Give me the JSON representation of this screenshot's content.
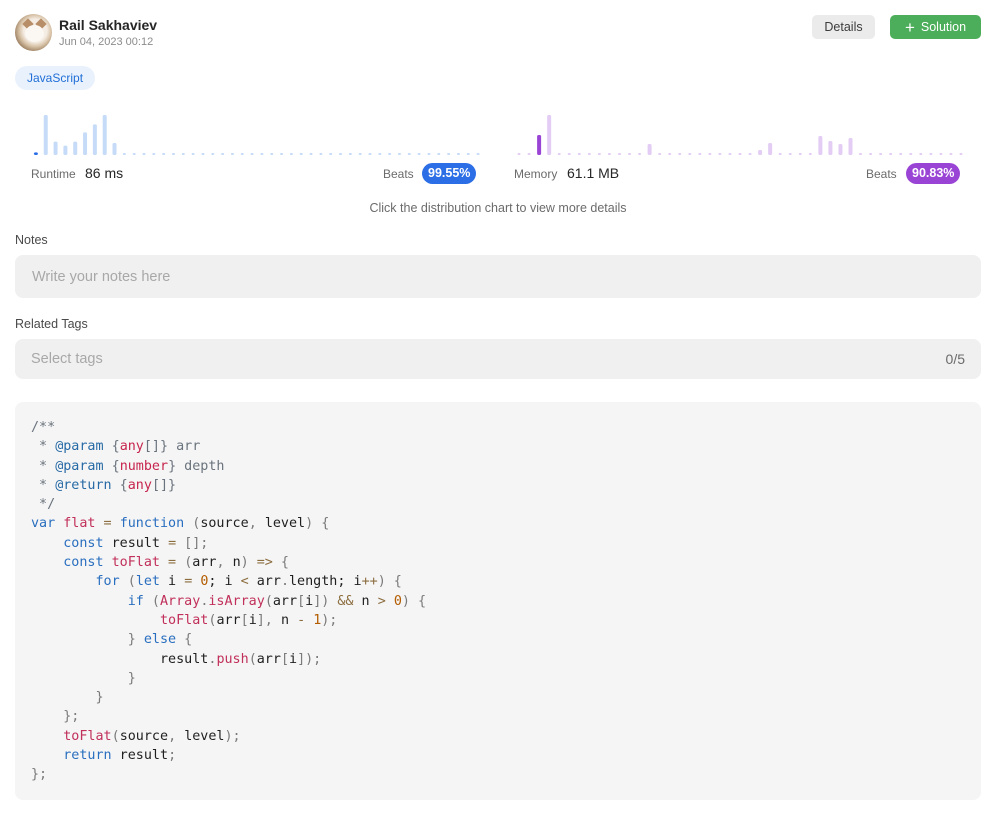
{
  "header": {
    "username": "Rail Sakhaviev",
    "date": "Jun 04, 2023 00:12",
    "details_label": "Details",
    "solution_label": "Solution"
  },
  "language_tag": "JavaScript",
  "runtime": {
    "label": "Runtime",
    "value": "86 ms",
    "beats_label": "Beats",
    "beats_value": "99.55%",
    "accent_color": "#2b6ee6",
    "bar_color": "#c5dbf7",
    "bars": [
      2,
      30,
      10,
      7,
      10,
      17,
      23,
      30,
      9,
      0,
      0,
      0,
      0,
      0,
      0,
      0,
      0,
      0,
      0,
      0,
      0,
      0,
      0,
      0,
      0,
      0,
      0,
      0,
      0,
      0,
      0,
      0,
      0,
      0,
      0,
      0,
      0,
      0,
      0,
      0,
      0,
      0,
      0,
      0,
      0,
      0
    ],
    "highlight_index": 0
  },
  "memory": {
    "label": "Memory",
    "value": "61.1 MB",
    "beats_label": "Beats",
    "beats_value": "90.83%",
    "accent_color": "#9a44d6",
    "bar_color": "#e3cdf4",
    "bars": [
      0,
      0,
      20,
      40,
      0,
      0,
      0,
      0,
      0,
      0,
      0,
      0,
      0,
      11,
      0,
      0,
      0,
      0,
      0,
      0,
      0,
      0,
      0,
      0,
      5,
      12,
      0,
      0,
      0,
      0,
      19,
      14,
      11,
      17,
      0,
      0,
      0,
      0,
      0,
      0,
      0,
      0,
      0,
      0,
      0
    ],
    "highlight_index": 2
  },
  "hint": "Click the distribution chart to view more details",
  "notes": {
    "label": "Notes",
    "placeholder": "Write your notes here"
  },
  "related_tags": {
    "label": "Related Tags",
    "placeholder": "Select tags",
    "count": "0/5"
  },
  "code": {
    "language": "javascript",
    "lines": [
      [
        [
          "/**",
          "comment"
        ]
      ],
      [
        [
          " * ",
          "comment"
        ],
        [
          "@param",
          "doctag"
        ],
        [
          " {",
          "comment"
        ],
        [
          "any",
          "type"
        ],
        [
          "[]} arr",
          "comment"
        ]
      ],
      [
        [
          " * ",
          "comment"
        ],
        [
          "@param",
          "doctag"
        ],
        [
          " {",
          "comment"
        ],
        [
          "number",
          "type"
        ],
        [
          "} depth",
          "comment"
        ]
      ],
      [
        [
          " * ",
          "comment"
        ],
        [
          "@return",
          "doctag"
        ],
        [
          " {",
          "comment"
        ],
        [
          "any",
          "type"
        ],
        [
          "[]}",
          "comment"
        ]
      ],
      [
        [
          " */",
          "comment"
        ]
      ],
      [
        [
          "var",
          "kw"
        ],
        [
          " ",
          "id"
        ],
        [
          "flat",
          "fn"
        ],
        [
          " = ",
          "op"
        ],
        [
          "function",
          "kw"
        ],
        [
          " (",
          "punc"
        ],
        [
          "source",
          "id"
        ],
        [
          ", ",
          "punc"
        ],
        [
          "level",
          "id"
        ],
        [
          ") {",
          "punc"
        ]
      ],
      [
        [
          "    ",
          "id"
        ],
        [
          "const",
          "kw"
        ],
        [
          " result ",
          "id"
        ],
        [
          "=",
          "op"
        ],
        [
          " [];",
          "punc"
        ]
      ],
      [
        [
          "    ",
          "id"
        ],
        [
          "const",
          "kw"
        ],
        [
          " ",
          "id"
        ],
        [
          "toFlat",
          "fn"
        ],
        [
          " = ",
          "op"
        ],
        [
          "(",
          "punc"
        ],
        [
          "arr",
          "id"
        ],
        [
          ", ",
          "punc"
        ],
        [
          "n",
          "id"
        ],
        [
          ") ",
          "punc"
        ],
        [
          "=>",
          "op"
        ],
        [
          " {",
          "punc"
        ]
      ],
      [
        [
          "        ",
          "id"
        ],
        [
          "for",
          "kw"
        ],
        [
          " (",
          "punc"
        ],
        [
          "let",
          "kw"
        ],
        [
          " i ",
          "id"
        ],
        [
          "=",
          "op"
        ],
        [
          " ",
          "id"
        ],
        [
          "0",
          "num"
        ],
        [
          "; i ",
          "id"
        ],
        [
          "<",
          "op"
        ],
        [
          " arr",
          "id"
        ],
        [
          ".",
          "punc"
        ],
        [
          "length",
          "id"
        ],
        [
          "; i",
          "id"
        ],
        [
          "++",
          "op"
        ],
        [
          ") {",
          "punc"
        ]
      ],
      [
        [
          "            ",
          "id"
        ],
        [
          "if",
          "kw"
        ],
        [
          " (",
          "punc"
        ],
        [
          "Array",
          "fn"
        ],
        [
          ".",
          "punc"
        ],
        [
          "isArray",
          "fn"
        ],
        [
          "(",
          "punc"
        ],
        [
          "arr",
          "id"
        ],
        [
          "[",
          "punc"
        ],
        [
          "i",
          "id"
        ],
        [
          "]) ",
          "punc"
        ],
        [
          "&&",
          "op"
        ],
        [
          " n ",
          "id"
        ],
        [
          ">",
          "op"
        ],
        [
          " ",
          "id"
        ],
        [
          "0",
          "num"
        ],
        [
          ") {",
          "punc"
        ]
      ],
      [
        [
          "                ",
          "id"
        ],
        [
          "toFlat",
          "fn"
        ],
        [
          "(",
          "punc"
        ],
        [
          "arr",
          "id"
        ],
        [
          "[",
          "punc"
        ],
        [
          "i",
          "id"
        ],
        [
          "], ",
          "punc"
        ],
        [
          "n ",
          "id"
        ],
        [
          "-",
          "op"
        ],
        [
          " ",
          "id"
        ],
        [
          "1",
          "num"
        ],
        [
          ");",
          "punc"
        ]
      ],
      [
        [
          "            ",
          "id"
        ],
        [
          "} ",
          "punc"
        ],
        [
          "else",
          "kw"
        ],
        [
          " {",
          "punc"
        ]
      ],
      [
        [
          "                ",
          "id"
        ],
        [
          "result",
          "id"
        ],
        [
          ".",
          "punc"
        ],
        [
          "push",
          "fn"
        ],
        [
          "(",
          "punc"
        ],
        [
          "arr",
          "id"
        ],
        [
          "[",
          "punc"
        ],
        [
          "i",
          "id"
        ],
        [
          "]);",
          "punc"
        ]
      ],
      [
        [
          "            }",
          "punc"
        ]
      ],
      [
        [
          "        }",
          "punc"
        ]
      ],
      [
        [
          "    };",
          "punc"
        ]
      ],
      [
        [
          "    ",
          "id"
        ],
        [
          "toFlat",
          "fn"
        ],
        [
          "(",
          "punc"
        ],
        [
          "source",
          "id"
        ],
        [
          ", ",
          "punc"
        ],
        [
          "level",
          "id"
        ],
        [
          ");",
          "punc"
        ]
      ],
      [
        [
          "    ",
          "id"
        ],
        [
          "return",
          "kw"
        ],
        [
          " result",
          "id"
        ],
        [
          ";",
          "punc"
        ]
      ],
      [
        [
          "};",
          "punc"
        ]
      ]
    ]
  }
}
